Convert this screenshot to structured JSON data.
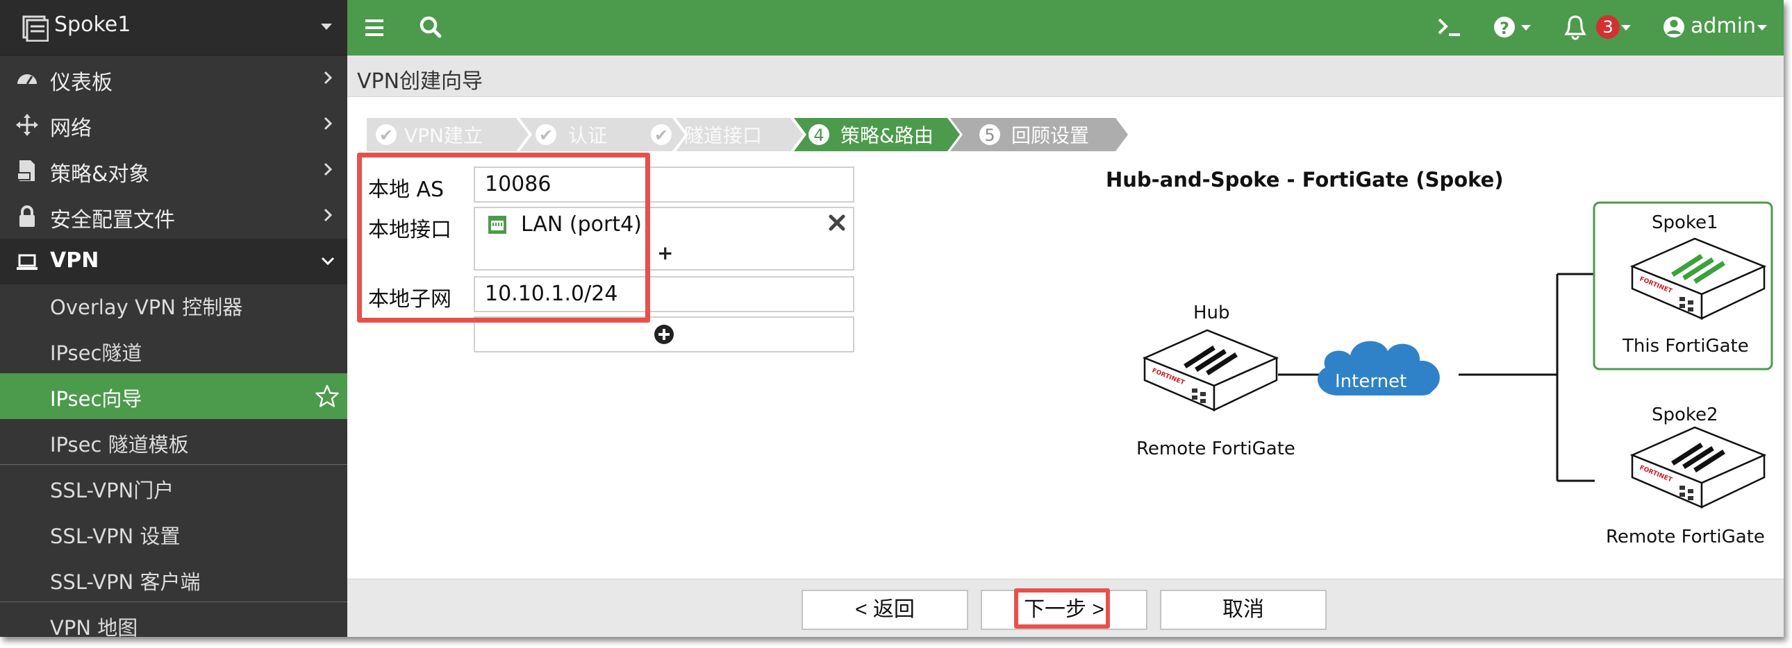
{
  "app": {
    "device_name": "Spoke1",
    "user": "admin",
    "notification_count": "3"
  },
  "sidebar": {
    "items": [
      {
        "label": "仪表板",
        "icon": "dashboard-icon"
      },
      {
        "label": "网络",
        "icon": "network-icon"
      },
      {
        "label": "策略&对象",
        "icon": "policy-icon"
      },
      {
        "label": "安全配置文件",
        "icon": "lock-icon"
      },
      {
        "label": "VPN",
        "icon": "laptop-icon"
      }
    ],
    "vpn_subitems": [
      "Overlay VPN 控制器",
      "IPsec隧道",
      "IPsec向导",
      "IPsec 隧道模板",
      "SSL-VPN门户",
      "SSL-VPN 设置",
      "SSL-VPN 客户端",
      "VPN 地图"
    ],
    "active_item": "IPsec向导"
  },
  "breadcrumb": {
    "title": "VPN创建向导"
  },
  "wizard": {
    "steps": [
      {
        "label": "VPN建立",
        "marker": "✔",
        "state": "done"
      },
      {
        "label": "认证",
        "marker": "✔",
        "state": "done"
      },
      {
        "label": "隧道接口",
        "marker": "✔",
        "state": "done"
      },
      {
        "label": "策略&路由",
        "marker": "4",
        "state": "current"
      },
      {
        "label": "回顾设置",
        "marker": "5",
        "state": "pending"
      }
    ]
  },
  "form": {
    "local_as_label": "本地 AS",
    "local_as_value": "10086",
    "local_interface_label": "本地接口",
    "local_interface_value": "LAN (port4)",
    "local_subnet_label": "本地子网",
    "local_subnet_value": "10.10.1.0/24",
    "add_symbol": "+"
  },
  "diagram": {
    "title": "Hub-and-Spoke - FortiGate (Spoke)",
    "hub_label": "Hub",
    "hub_caption": "Remote FortiGate",
    "internet_label": "Internet",
    "spoke1_label": "Spoke1",
    "spoke1_caption": "This FortiGate",
    "spoke2_label": "Spoke2",
    "spoke2_caption": "Remote FortiGate",
    "device_brand": "FORTINET"
  },
  "footer": {
    "back_label": "< 返回",
    "next_label": "下一步 >",
    "cancel_label": "取消"
  },
  "colors": {
    "brand_green": "#4c9a4c",
    "sidebar_bg": "#363636",
    "highlight_red": "#e8514a",
    "badge_red": "#d33131",
    "cloud_blue": "#2f82c8"
  }
}
